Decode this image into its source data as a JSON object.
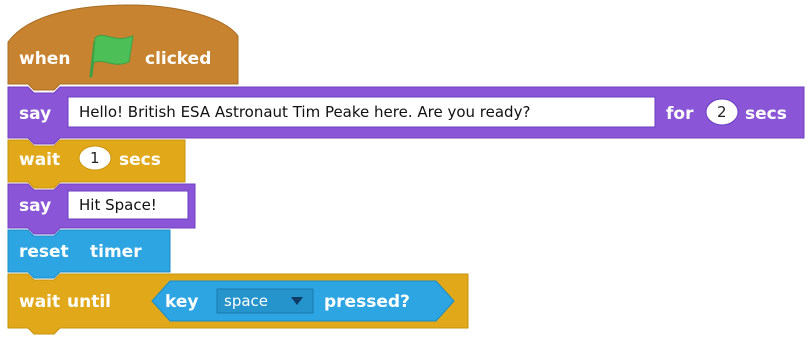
{
  "blocks": {
    "hat": {
      "when": "when",
      "clicked": "clicked",
      "flag_icon": "green-flag-icon"
    },
    "say1": {
      "say": "say",
      "message": "Hello! British ESA Astronaut Tim Peake here. Are you ready?",
      "for": "for",
      "seconds": "2",
      "secs": "secs"
    },
    "wait1": {
      "wait": "wait",
      "seconds": "1",
      "secs": "secs"
    },
    "say2": {
      "say": "say",
      "message": "Hit Space!"
    },
    "reset": {
      "reset": "reset",
      "timer": "timer"
    },
    "wait_until": {
      "wait": "wait",
      "until": "until",
      "key": "key",
      "key_value": "space",
      "pressed": "pressed?"
    }
  },
  "colors": {
    "events": "#c88330",
    "looks": "#8a55d7",
    "control": "#e1a91a",
    "sensing": "#2ca5e2",
    "flag": "#4cbf56"
  }
}
